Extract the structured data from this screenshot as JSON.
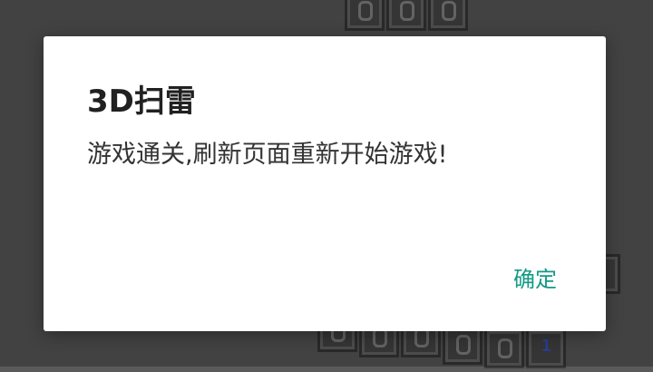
{
  "dialog": {
    "title": "3D扫雷",
    "message": "游戏通关,刷新页面重新开始游戏!",
    "confirm_label": "确定"
  },
  "board": {
    "visible_number": "1",
    "number_color": "#3a57c8"
  },
  "colors": {
    "accent": "#139a86",
    "scrim": "#5a5a5a",
    "dialog_bg": "#ffffff"
  }
}
